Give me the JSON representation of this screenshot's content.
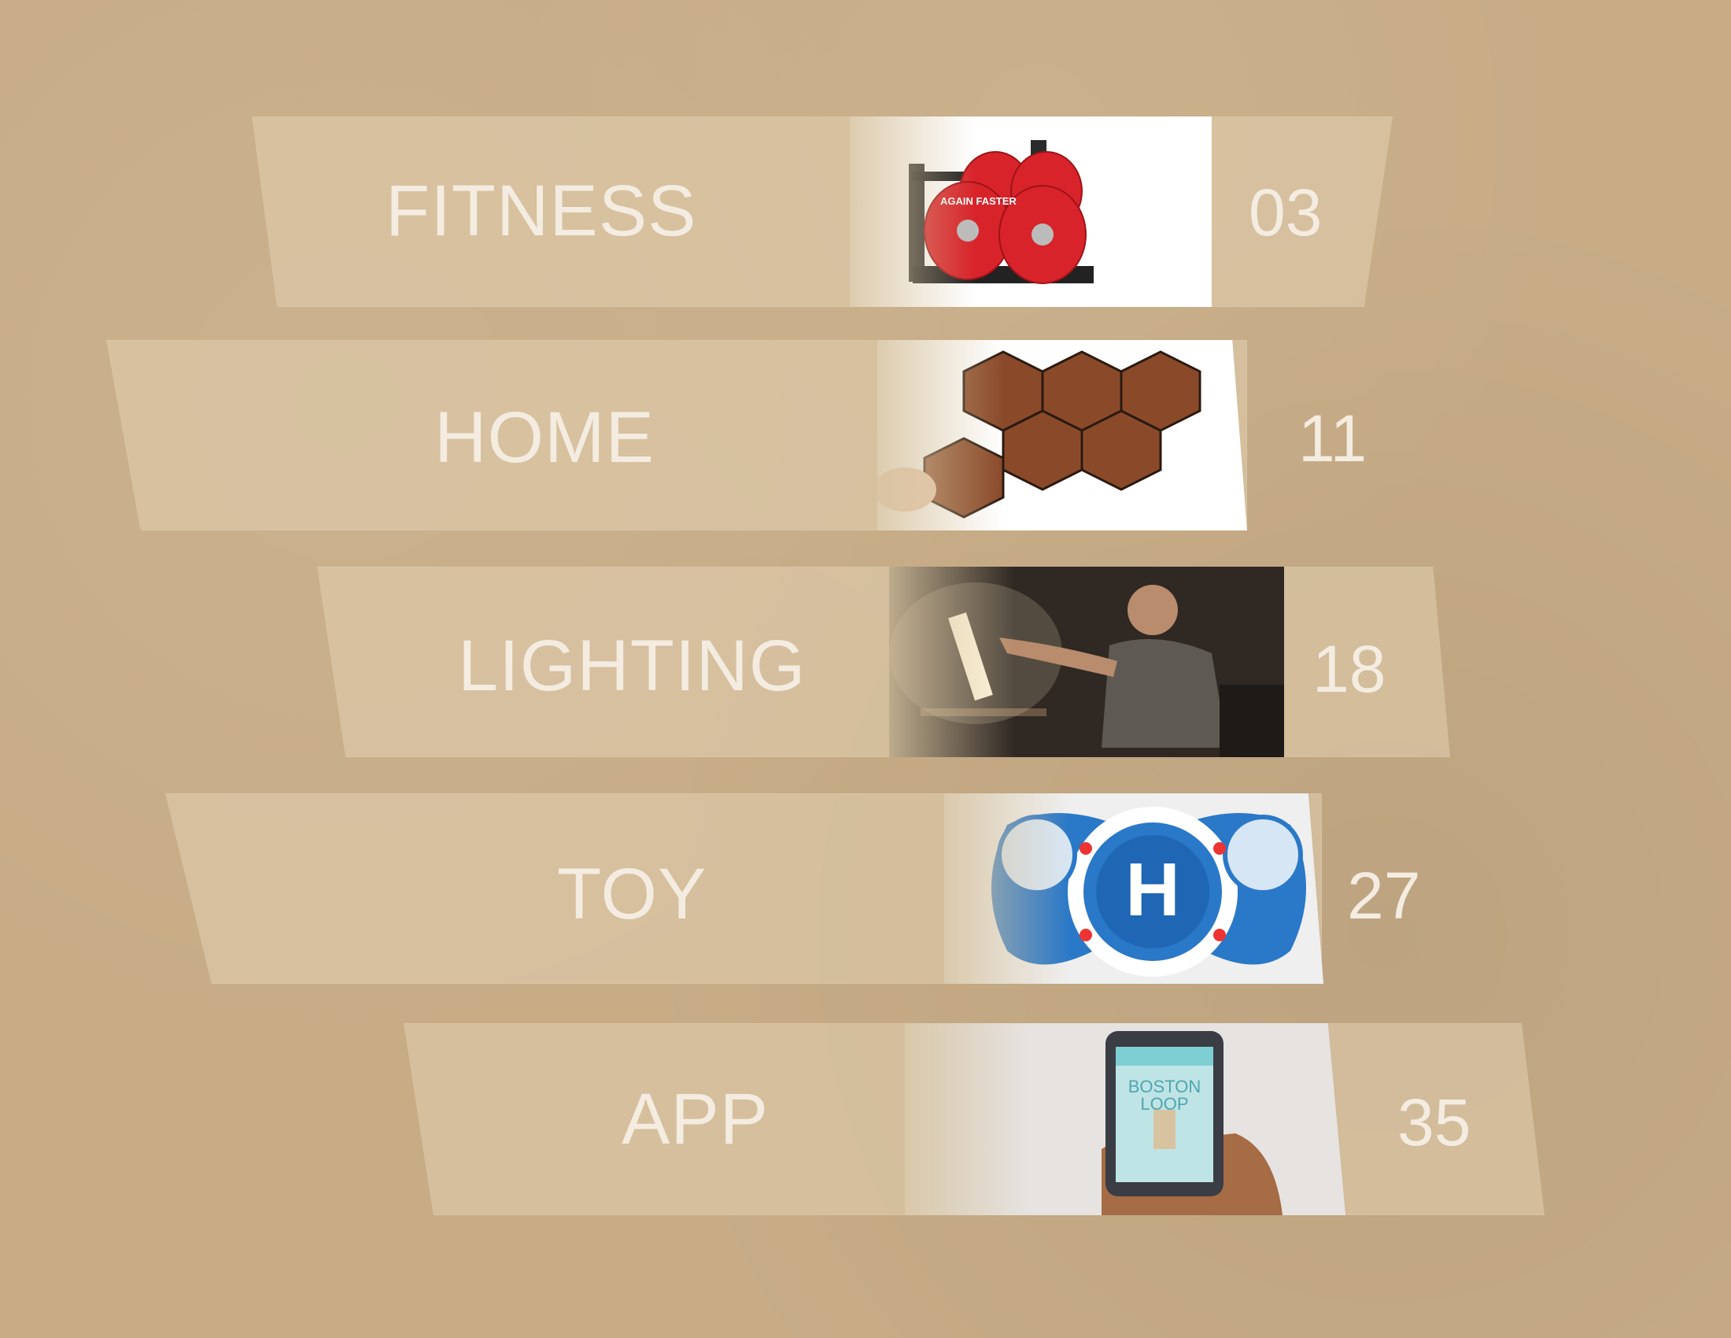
{
  "sections": [
    {
      "label": "FITNESS",
      "page": "03",
      "image_icon": "weight-plate-rack-icon"
    },
    {
      "label": "HOME",
      "page": "11",
      "image_icon": "hexagon-tiles-icon"
    },
    {
      "label": "LIGHTING",
      "page": "18",
      "image_icon": "lamp-man-icon"
    },
    {
      "label": "TOY",
      "page": "27",
      "image_icon": "remote-controller-icon"
    },
    {
      "label": "APP",
      "page": "35",
      "image_icon": "phone-in-hand-icon"
    }
  ],
  "images": {
    "fitness_plate_text": "AGAIN FASTER",
    "app_screen_title": "BOSTON LOOP"
  },
  "colors": {
    "background": "#c7ac86",
    "band": "#e2d0b0",
    "text": "#f4ece0",
    "plate_red": "#d8232a",
    "toy_blue": "#2a78c8"
  }
}
